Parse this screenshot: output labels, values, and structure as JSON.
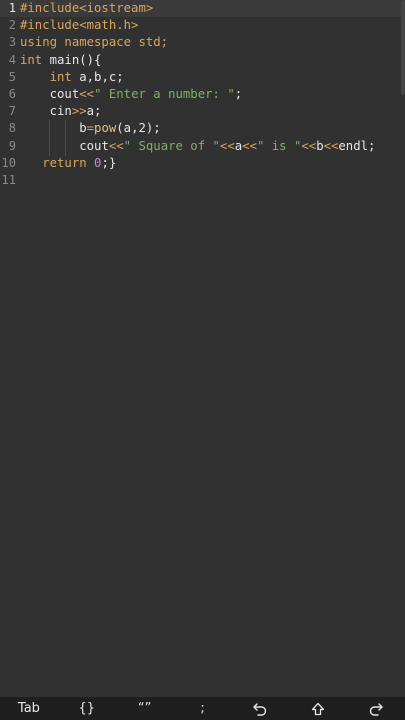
{
  "editor": {
    "line_numbers": [
      "1",
      "2",
      "3",
      "4",
      "5",
      "6",
      "7",
      "8",
      "9",
      "10",
      "11"
    ],
    "lines": [
      {
        "t1": "#include<iostream>"
      },
      {
        "t1": "#include<math.h>"
      },
      {
        "t1": "using namespace std;"
      },
      {
        "kw": "int",
        "t2": " main(){"
      },
      {
        "indent": "    ",
        "kw": "int",
        "t2": " a,b,c;"
      },
      {
        "indent": "    ",
        "a": "cout",
        "op": "<<",
        "s": "\" Enter a number: \"",
        "e": ";"
      },
      {
        "indent": "    ",
        "a": "cin",
        "op": ">>",
        "e": "a;"
      },
      {
        "indent": "        ",
        "a": "b",
        "op": "=",
        "fn": "pow",
        "e": "(a,2);"
      },
      {
        "indent": "        ",
        "a": "cout",
        "op": "<<",
        "s": "\" Square of \"",
        "op2": "<<",
        "m": "a",
        "op3": "<<",
        "s2": "\" is \"",
        "op4": "<<",
        "m2": "b",
        "op5": "<<",
        "e": "endl;"
      },
      {
        "indent": "   ",
        "kw": "return",
        "num": " 0",
        "e": ";}"
      },
      {
        "t1": ""
      }
    ]
  },
  "toolbar": {
    "tab_label": "Tab",
    "braces_label": "{}",
    "quotes_label": "“”",
    "semicolon_label": ";"
  },
  "icons": {
    "undo": "undo-icon",
    "shift": "shift-icon",
    "redo": "redo-icon"
  },
  "colors": {
    "background": "#313131",
    "keyword": "#d9a65c",
    "string": "#7fb06a",
    "number": "#b58cd6",
    "toolbar": "#1f1f1f"
  }
}
